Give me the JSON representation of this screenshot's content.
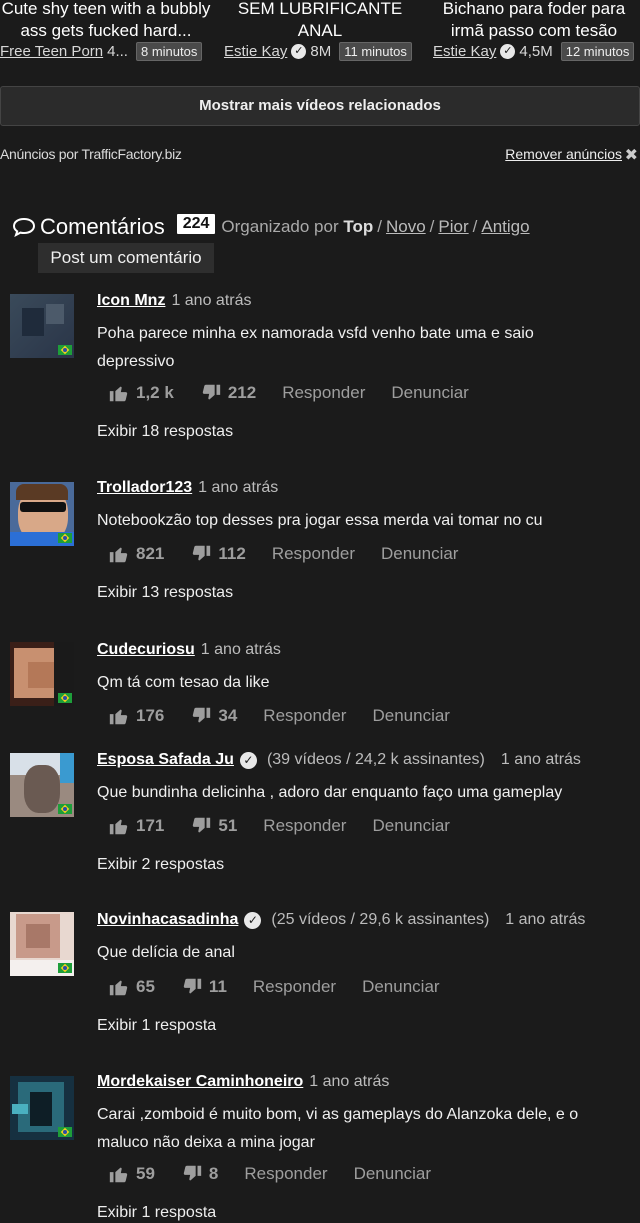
{
  "related": [
    {
      "title_line1": "Cute shy teen with a bubbly",
      "title_line2": "ass gets fucked hard...",
      "channel": "Free Teen Porn",
      "views": "4...",
      "duration": "8 minutos",
      "verified": false
    },
    {
      "title_line1": "SEM LUBRIFICANTE",
      "title_line2": "ANAL",
      "channel": "Estie Kay",
      "views": "8M",
      "duration": "11 minutos",
      "verified": true
    },
    {
      "title_line1": "Bichano para foder para",
      "title_line2": "irmã passo com tesão",
      "channel": "Estie Kay",
      "views": "4,5M",
      "duration": "12 minutos",
      "verified": true
    }
  ],
  "more_button": "Mostrar mais vídeos relacionados",
  "ads": {
    "by": "Anúncios por TrafficFactory.biz",
    "remove": "Remover anúncios",
    "close": "✖"
  },
  "comments_header": {
    "title": "Comentários",
    "count": "224",
    "sorted_by": "Organizado por",
    "sort_top": "Top",
    "sort_new": "Novo",
    "sort_worst": "Pior",
    "sort_old": "Antigo",
    "post": "Post um comentário"
  },
  "action_labels": {
    "reply": "Responder",
    "report": "Denunciar"
  },
  "comments": [
    {
      "user": "Icon Mnz",
      "time": "1 ano atrás",
      "text": "Poha parece minha ex namorada vsfd venho bate uma e saio depressivo",
      "likes": "1,2 k",
      "dislikes": "212",
      "replies": "Exibir 18 respostas",
      "avatar_colors": [
        "#3a4a5a",
        "#2a3548"
      ]
    },
    {
      "user": "Trollador123",
      "time": "1 ano atrás",
      "text": "Notebookzão top desses pra jogar essa merda vai tomar no cu",
      "likes": "821",
      "dislikes": "112",
      "replies": "Exibir 13 respostas",
      "avatar_colors": [
        "#5a4030",
        "#2b6fd6"
      ]
    },
    {
      "user": "Cudecuriosu",
      "time": "1 ano atrás",
      "text": "Qm tá com tesao da like",
      "likes": "176",
      "dislikes": "34",
      "replies": "",
      "avatar_colors": [
        "#b87a5a",
        "#4a2a20"
      ]
    },
    {
      "user": "Esposa Safada Ju",
      "stats": "(39 vídeos / 24,2 k assinantes)",
      "time": "1 ano atrás",
      "text": "Que bundinha delicinha , adoro dar enquanto faço uma gameplay",
      "likes": "171",
      "dislikes": "51",
      "replies": "Exibir 2 respostas",
      "avatar_colors": [
        "#6a6a6a",
        "#8a6a5a"
      ]
    },
    {
      "user": "Novinhacasadinha",
      "stats": "(25 vídeos / 29,6 k assinantes)",
      "time": "1 ano atrás",
      "text": "Que delícia de anal",
      "likes": "65",
      "dislikes": "11",
      "replies": "Exibir 1 resposta",
      "avatar_colors": [
        "#c89a8a",
        "#e8d0c8"
      ]
    },
    {
      "user": "Mordekaiser Caminhoneiro",
      "time": "1 ano atrás",
      "text": "Carai ,zomboid é muito bom, vi as gameplays do Alanzoka dele, e o maluco não deixa a mina jogar",
      "likes": "59",
      "dislikes": "8",
      "replies": "Exibir 1 resposta",
      "avatar_colors": [
        "#1f4a5a",
        "#3a7a8a"
      ]
    }
  ]
}
